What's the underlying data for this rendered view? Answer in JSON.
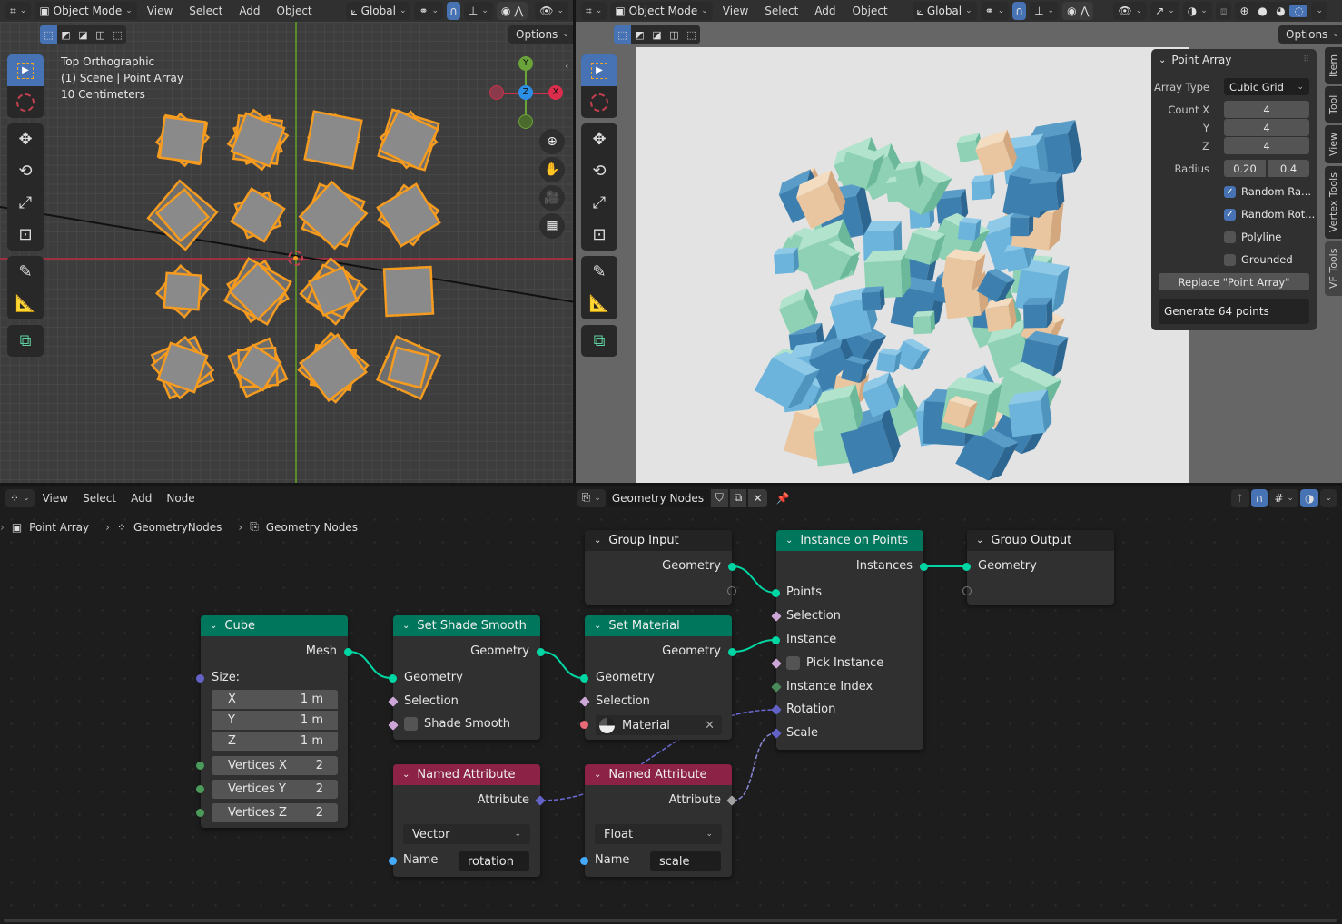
{
  "left_viewport": {
    "header": {
      "editor_icon": "viewport-editor-icon",
      "mode": "Object Mode",
      "menus": [
        "View",
        "Select",
        "Add",
        "Object"
      ],
      "orientation": "Global",
      "options_label": "Options"
    },
    "overlay_text": [
      "Top Orthographic",
      "(1) Scene | Point Array",
      "10 Centimeters"
    ],
    "gizmo": {
      "x": "X",
      "y": "Y",
      "z": "Z"
    }
  },
  "right_viewport": {
    "header": {
      "mode": "Object Mode",
      "menus": [
        "View",
        "Select",
        "Add",
        "Object"
      ],
      "orientation": "Global",
      "options_label": "Options"
    }
  },
  "point_array_panel": {
    "title": "Point Array",
    "array_type_label": "Array Type",
    "array_type_value": "Cubic Grid",
    "count_x_label": "Count X",
    "count_x": "4",
    "count_y_label": "Y",
    "count_y": "4",
    "count_z_label": "Z",
    "count_z": "4",
    "radius_label": "Radius",
    "radius_min": "0.20",
    "radius_max": "0.4",
    "checkboxes": [
      {
        "label": "Random Ra...",
        "checked": true
      },
      {
        "label": "Random Rot...",
        "checked": true
      },
      {
        "label": "Polyline",
        "checked": false
      },
      {
        "label": "Grounded",
        "checked": false
      }
    ],
    "replace_button": "Replace \"Point Array\"",
    "generate_text": "Generate 64 points"
  },
  "sidebar_tabs": [
    "Item",
    "Tool",
    "View",
    "Vertex Tools",
    "VF Tools"
  ],
  "node_editor": {
    "menus": [
      "View",
      "Select",
      "Add",
      "Node"
    ],
    "node_group_name": "Geometry Nodes",
    "breadcrumb": [
      "Point Array",
      "GeometryNodes",
      "Geometry Nodes"
    ],
    "nodes": {
      "cube": {
        "title": "Cube",
        "output_mesh": "Mesh",
        "size_label": "Size:",
        "size": [
          {
            "axis": "X",
            "value": "1 m"
          },
          {
            "axis": "Y",
            "value": "1 m"
          },
          {
            "axis": "Z",
            "value": "1 m"
          }
        ],
        "vertices": [
          {
            "label": "Vertices X",
            "value": "2"
          },
          {
            "label": "Vertices Y",
            "value": "2"
          },
          {
            "label": "Vertices Z",
            "value": "2"
          }
        ]
      },
      "set_shade_smooth": {
        "title": "Set Shade Smooth",
        "output": "Geometry",
        "inputs": [
          "Geometry",
          "Selection",
          "Shade Smooth"
        ]
      },
      "group_input": {
        "title": "Group Input",
        "output": "Geometry"
      },
      "set_material": {
        "title": "Set Material",
        "output": "Geometry",
        "inputs": [
          "Geometry",
          "Selection"
        ],
        "material": "Material"
      },
      "instance_on_points": {
        "title": "Instance on Points",
        "output": "Instances",
        "inputs": [
          "Points",
          "Selection",
          "Instance",
          "Pick Instance",
          "Instance Index",
          "Rotation",
          "Scale"
        ]
      },
      "group_output": {
        "title": "Group Output",
        "input": "Geometry"
      },
      "named_attr_rotation": {
        "title": "Named Attribute",
        "output": "Attribute",
        "type": "Vector",
        "name_label": "Name",
        "name_value": "rotation"
      },
      "named_attr_scale": {
        "title": "Named Attribute",
        "output": "Attribute",
        "type": "Float",
        "name_label": "Name",
        "name_value": "scale"
      }
    }
  },
  "colors": {
    "accent": "#4772b3",
    "geometry_socket": "#00d6a3",
    "geometry_header": "#00775c",
    "attribute_header": "#8c2246",
    "selection_orange": "#f59b1f",
    "vector_socket": "#6363c7"
  }
}
